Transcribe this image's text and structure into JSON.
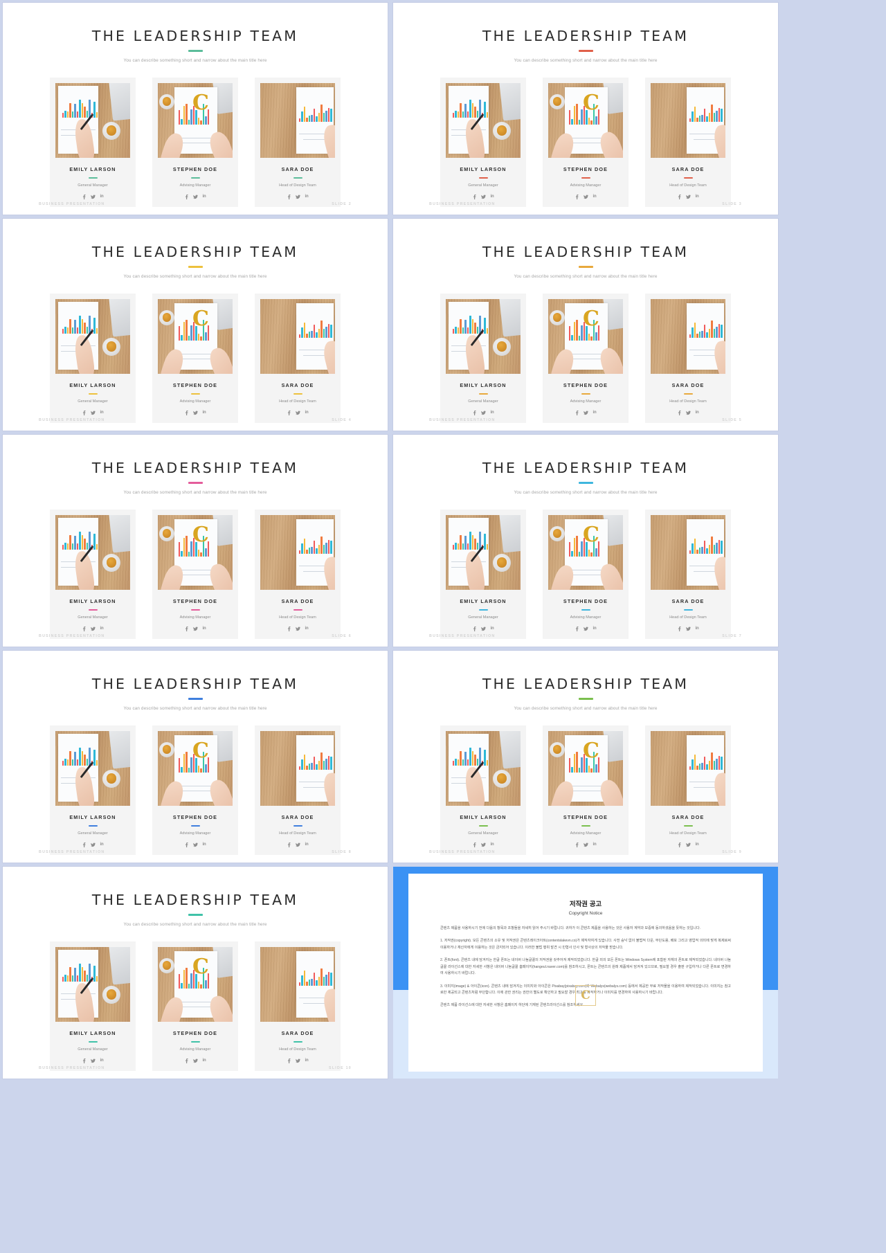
{
  "deck": {
    "title": "THE LEADERSHIP TEAM",
    "subtitle": "You can describe something short and narrow about the main title here",
    "footer_left": "BUSINESS PRESENTATION"
  },
  "members": [
    {
      "name": "EMILY LARSON",
      "role": "General Manager"
    },
    {
      "name": "STEPHEN DOE",
      "role": "Advising Manager"
    },
    {
      "name": "SARA DOE",
      "role": "Head of Design Team"
    }
  ],
  "social_icons": [
    "facebook-icon",
    "twitter-icon",
    "linkedin-icon"
  ],
  "slides": [
    {
      "number": "SLIDE 2",
      "accent": "#5bbd9a"
    },
    {
      "number": "SLIDE 3",
      "accent": "#e0604a"
    },
    {
      "number": "SLIDE 4",
      "accent": "#edc13c"
    },
    {
      "number": "SLIDE 5",
      "accent": "#e8a93c"
    },
    {
      "number": "SLIDE 6",
      "accent": "#e45d9b"
    },
    {
      "number": "SLIDE 7",
      "accent": "#3fb6de"
    },
    {
      "number": "SLIDE 8",
      "accent": "#3f7fde"
    },
    {
      "number": "SLIDE 9",
      "accent": "#7bbf4e"
    },
    {
      "number": "SLIDE 10",
      "accent": "#3fc2a8"
    }
  ],
  "copyright": {
    "title_ko": "저작권 공고",
    "title_en": "Copyright Notice",
    "watermark": "C",
    "paragraphs": [
      "콘텐츠 제품을 사용하시기 전에 다음의 항목과 조항들을 자세히 읽어 주시기 바랍니다. 귀하가 이 콘텐츠 제품을 사용하는 것은 사용자 계약과 보증에 동의하셨음을 뜻하는 것입니다.",
      "1. 저작권(copyright). 모든 콘텐츠의 소유 및 저작권은 콘텐츠레이크아트(contentslakevn.co)가 제작자여게 있습니다. 사전 승낙 없이 불법적 다운, 무단도용, 배포 그리고 영업적 의미에 맞게 복제로써 이용하거나 재산자에게 이용하는 것은 금지되어 있습니다. 이러한 불법 행위 발견 시 민형사 인사 및 형사상의 저작물 받습니다.",
      "2. 폰트(font). 콘텐츠 내에 담겨지는 한글 폰트는 네이버 나눔글꼴의 저작권을 갖추어져 제작되었습니다. 한글 외의 모든 폰트는 Windows System에 포함된 자체의 폰트로 제작되었습니다. 네이버 나눔글꼴 라이선스에 대한 자세한 사항은 네이버 나눔글꼴 홈페이지(hangeul.naver.com)를 참조하시고, 폰트는 콘텐츠의 원래 제품에서 담겨져 있으므로, 필요할 경우 출판 구입하거나 다른 폰트로 변경하여 사용하시기 바랍니다.",
      "3. 이미지(image) & 아이콘(icon). 콘텐츠 내에 담겨지는 이미지와 아이콘은 Pixabay(pixabay.com)와 Webalys(webalys.com) 등에서 제공한 무료 저작물을 이용하여 제작되었습니다. 이미지는 참고로만 제공되고 콘텐츠처럼 무단합니다. 이에 관한 권리는 권한의 별도로 확인하고 필요할 경우 최고를 최적하거나 이미지를 변경하여 사용하시기 바랍니다.",
      "콘텐츠 제품 라이선스에 대한 자세한 사항은 홈페이지 하단에 기재된 콘텐츠라이선스를 참조하세요."
    ]
  }
}
